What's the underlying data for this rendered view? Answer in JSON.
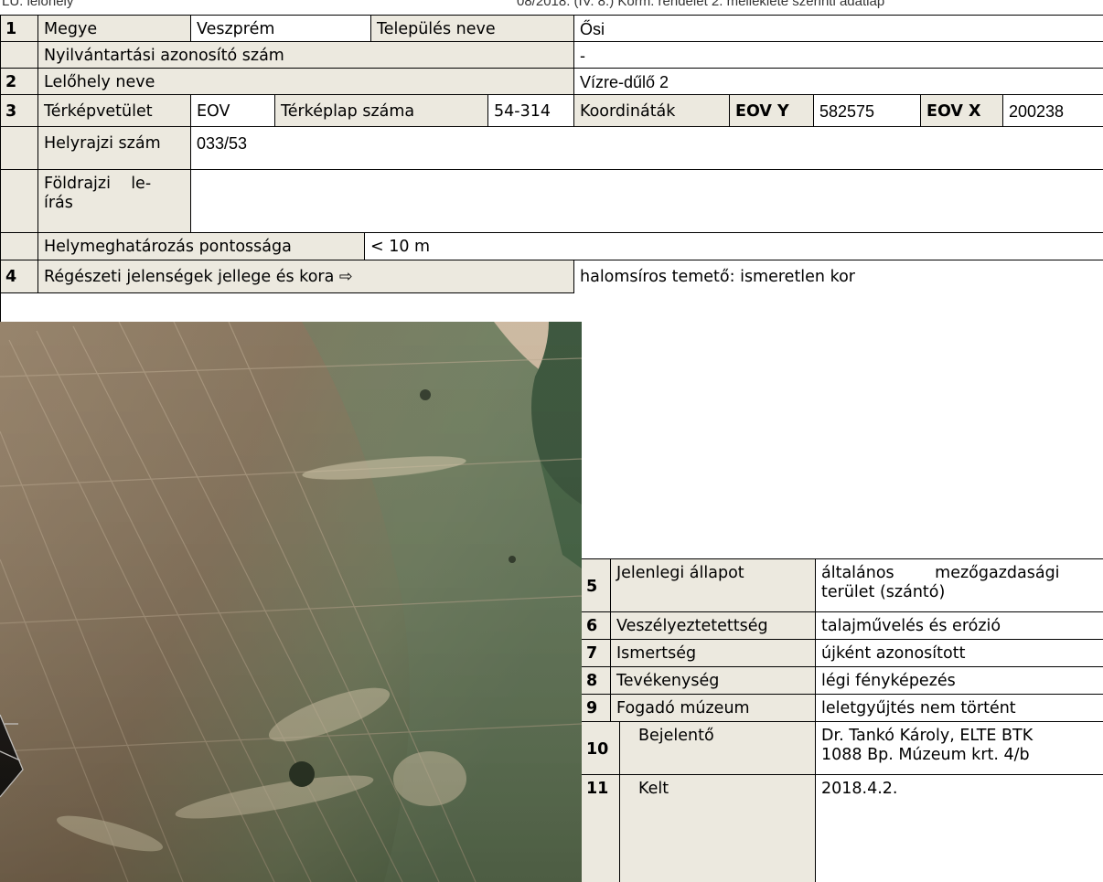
{
  "header": {
    "left": "LU. lelőhely",
    "right": "08/2018. (IV. 8.) Korm. rendelet 2. melléklete szerinti adatlap"
  },
  "rows": {
    "r1": {
      "num": "1",
      "megye_label": "Megye",
      "megye": "Veszprém",
      "telepules_label": "Település neve",
      "telepules": "Ősi"
    },
    "r1b": {
      "label": "Nyilvántartási azonosító szám",
      "value": "-"
    },
    "r2": {
      "num": "2",
      "label": "Lelőhely neve",
      "value": "Vízre-dűlő 2"
    },
    "r3": {
      "num": "3",
      "terkep_label": "Térképvetület",
      "terkep": "EOV",
      "terkeplap_label": "Térképlap száma",
      "terkeplap": "54-314",
      "koord_label": "Koordináták",
      "eovy_label": "EOV Y",
      "eovy": "582575",
      "eovx_label": "EOV X",
      "eovx": "200238"
    },
    "r3b": {
      "label": "Helyrajzi szám",
      "value": "033/53"
    },
    "r3c": {
      "label_line1": "Földrajzi    le-",
      "label_line2": "írás",
      "value": ""
    },
    "r3d": {
      "label": "Helymeghatározás pontossága",
      "value": "< 10 m"
    },
    "r4": {
      "num": "4",
      "label": "Régészeti jelenségek jellege és kora ⇨",
      "value": "halomsíros temető: ismeretlen kor"
    }
  },
  "details": [
    {
      "num": "5",
      "label": "Jelenlegi állapot",
      "value_line1": "általános        mezőgazdasági",
      "value_line2": "terület (szántó)"
    },
    {
      "num": "6",
      "label": "Veszélyeztetettség",
      "value": "talajművelés és erózió"
    },
    {
      "num": "7",
      "label": "Ismertség",
      "value": "újként azonosított"
    },
    {
      "num": "8",
      "label": "Tevékenység",
      "value": "légi fényképezés"
    },
    {
      "num": "9",
      "label": "Fogadó múzeum",
      "value": "leletgyűjtés nem történt"
    },
    {
      "num": "10",
      "label": "Bejelentő",
      "value_line1": "Dr. Tankó Károly, ELTE BTK",
      "value_line2": "1088 Bp. Múzeum krt. 4/b"
    },
    {
      "num": "11",
      "label": "Kelt",
      "value": "2018.4.2."
    }
  ],
  "colors": {
    "label_bg": "#ece9df",
    "border": "#000000",
    "photo_field": "#8e7558",
    "photo_crop": "#6f7f57",
    "photo_forest": "#2f4a30"
  }
}
